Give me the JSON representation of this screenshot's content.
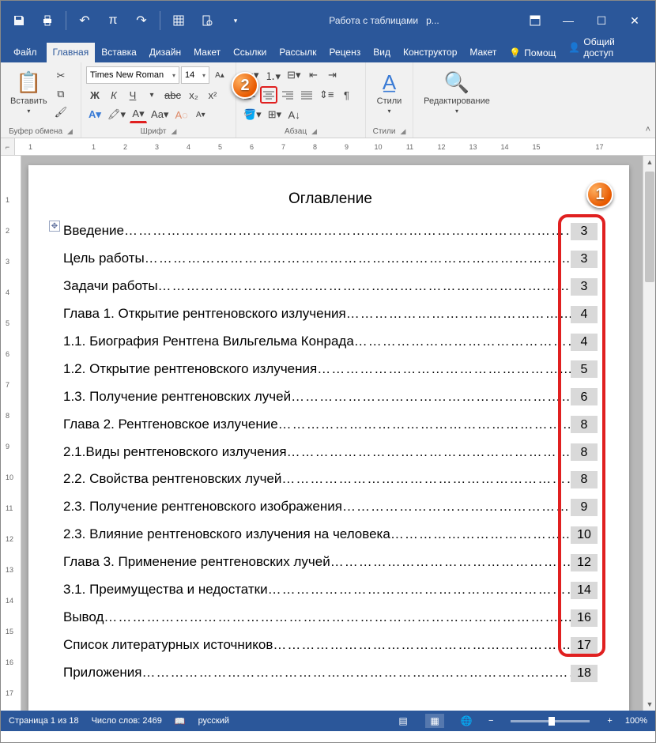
{
  "titlebar": {
    "center_left": "Работа с таблицами",
    "center_right": "р..."
  },
  "tabs": {
    "file": "Файл",
    "home": "Главная",
    "insert": "Вставка",
    "design": "Дизайн",
    "layout": "Макет",
    "references": "Ссылки",
    "mailings": "Рассылк",
    "review": "Реценз",
    "view": "Вид",
    "table_design": "Конструктор",
    "table_layout": "Макет",
    "help": "Помощ",
    "share": "Общий доступ"
  },
  "ribbon": {
    "clipboard": {
      "paste": "Вставить",
      "label": "Буфер обмена"
    },
    "font": {
      "name": "Times New Roman",
      "size": "14",
      "label": "Шрифт",
      "bold": "Ж",
      "italic": "К",
      "underline": "Ч",
      "strike": "abc",
      "sub": "x₂",
      "sup": "x²"
    },
    "paragraph": {
      "label": "Абзац"
    },
    "styles": {
      "big": "Стили",
      "label": "Стили"
    },
    "editing": {
      "big": "Редактирование"
    }
  },
  "ruler": {
    "marks": [
      "1",
      "",
      "1",
      "2",
      "3",
      "4",
      "5",
      "6",
      "7",
      "8",
      "9",
      "10",
      "11",
      "12",
      "13",
      "14",
      "15",
      "",
      "17"
    ]
  },
  "vruler_marks": [
    "",
    "1",
    "2",
    "3",
    "4",
    "5",
    "6",
    "7",
    "8",
    "9",
    "10",
    "11",
    "12",
    "13",
    "14",
    "15",
    "16",
    "17"
  ],
  "document": {
    "title": "Оглавление",
    "toc": [
      {
        "text": "Введение",
        "page": "3"
      },
      {
        "text": " Цель работы",
        "page": "3"
      },
      {
        "text": "Задачи работы",
        "page": "3"
      },
      {
        "text": "Глава 1. Открытие рентгеновского излучения",
        "page": "4"
      },
      {
        "text": "1.1. Биография Рентгена Вильгельма Конрада",
        "page": "4"
      },
      {
        "text": "1.2. Открытие рентгеновского излучения ",
        "page": "5"
      },
      {
        "text": "1.3. Получение рентгеновских лучей",
        "page": "6"
      },
      {
        "text": "Глава 2. Рентгеновское излучение",
        "page": "8"
      },
      {
        "text": "2.1.Виды рентгеновского излучения",
        "page": "8"
      },
      {
        "text": "2.2. Свойства рентгеновских лучей",
        "page": "8"
      },
      {
        "text": "2.3. Получение рентгеновского изображения",
        "page": "9"
      },
      {
        "text": "2.3. Влияние рентгеновского излучения на человека",
        "page": "10"
      },
      {
        "text": "Глава 3. Применение рентгеновских лучей",
        "page": "12"
      },
      {
        "text": "3.1. Преимущества и недостатки",
        "page": "14"
      },
      {
        "text": "Вывод",
        "page": "16"
      },
      {
        "text": "Список литературных источников",
        "page": "17"
      },
      {
        "text": "Приложения",
        "page": "18"
      }
    ]
  },
  "callouts": {
    "one": "1",
    "two": "2"
  },
  "statusbar": {
    "page": "Страница 1 из 18",
    "words": "Число слов: 2469",
    "lang": "русский",
    "zoom": "100%"
  }
}
